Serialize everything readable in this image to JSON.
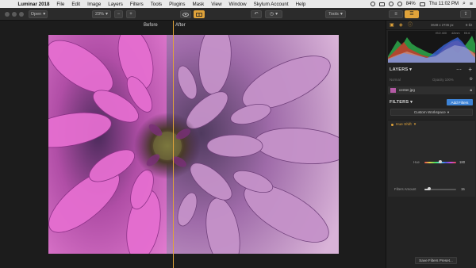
{
  "menubar": {
    "apple": "",
    "app_name": "Luminar 2018",
    "items": [
      "File",
      "Edit",
      "Image",
      "Layers",
      "Filters",
      "Tools",
      "Plugins",
      "Mask",
      "View",
      "Window",
      "Skylum Account",
      "Help"
    ],
    "battery": "84%",
    "clock": "Thu 11:02 PM"
  },
  "toolbar": {
    "open_label": "Open",
    "zoom_label": "23%",
    "minus_glyph": "−",
    "plus_glyph": "+",
    "tools_label": "Tools",
    "compare_active": true
  },
  "canvas": {
    "before_label": "Before",
    "after_label": "After",
    "split_position_fraction": 0.43
  },
  "panel": {
    "image_dims": "3648 x 2736 px",
    "bit_depth": "8-bit",
    "exif": [
      "ISO 400",
      "42mm",
      "f/5.6"
    ],
    "layers": {
      "title": "LAYERS",
      "normal_label": "Normal",
      "opacity_label": "Opacity 100%",
      "layer_name": "center.jpg"
    },
    "filters": {
      "title": "FILTERS",
      "add_filters_label": "Add Filters",
      "workspace_label": "Custom Workspace",
      "filter_name": "Hue Shift",
      "hue": {
        "label": "Hue",
        "value": "180",
        "fraction": 0.5
      },
      "amount": {
        "label": "Filters Amount",
        "value": "15",
        "fraction": 0.15
      }
    },
    "save_preset_label": "Save Filters Preset..."
  },
  "colors": {
    "accent": "#e0a33a",
    "blue": "#3d83d6"
  }
}
